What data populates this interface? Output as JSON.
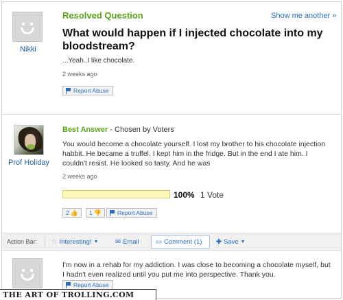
{
  "question": {
    "header": "Resolved Question",
    "show_more": "Show me another »",
    "asker": "Nikki",
    "title": "What would happen if I injected chocolate into my bloodstream?",
    "details": "...Yeah..I like chocolate.",
    "age": "2 weeks ago",
    "report": "Report Abuse"
  },
  "best_answer": {
    "label": "Best Answer",
    "chosen_by": " - Chosen by Voters",
    "answerer": "Prof Holiday",
    "text": "You would become a chocolate yourself. I lost my brother to his chocolate injection habbit. He became a truffel. I kept him in the fridge. But in the end I ate him. I couldn't resist. He looked so tasty. And he was",
    "age": "2 weeks ago",
    "vote_percent": "100%",
    "vote_count": "1 Vote",
    "vote_fraction": 1.0,
    "thumbs_up": "2",
    "thumbs_down": "1",
    "report": "Report Abuse"
  },
  "action_bar": {
    "label": "Action Bar:",
    "interesting": "Interesting!",
    "email": "Email",
    "comment": "Comment (1)",
    "save": "Save"
  },
  "comment": {
    "text": "I'm now in a rehab for my addiction. I was close to becoming a chocolate myself, but I hadn't even realized until you put me into perspective. Thank you.",
    "report": "Report Abuse"
  },
  "watermark": "THE ART OF TROLLING.COM",
  "colors": {
    "accent_green": "#5aa119",
    "link_blue": "#2a6fbf",
    "vote_bar": "#fdf7b8"
  },
  "icons": [
    "flag-icon",
    "thumbs-up-icon",
    "thumbs-down-icon",
    "star-icon",
    "email-icon",
    "comment-icon",
    "plus-icon",
    "avatar-icon"
  ]
}
